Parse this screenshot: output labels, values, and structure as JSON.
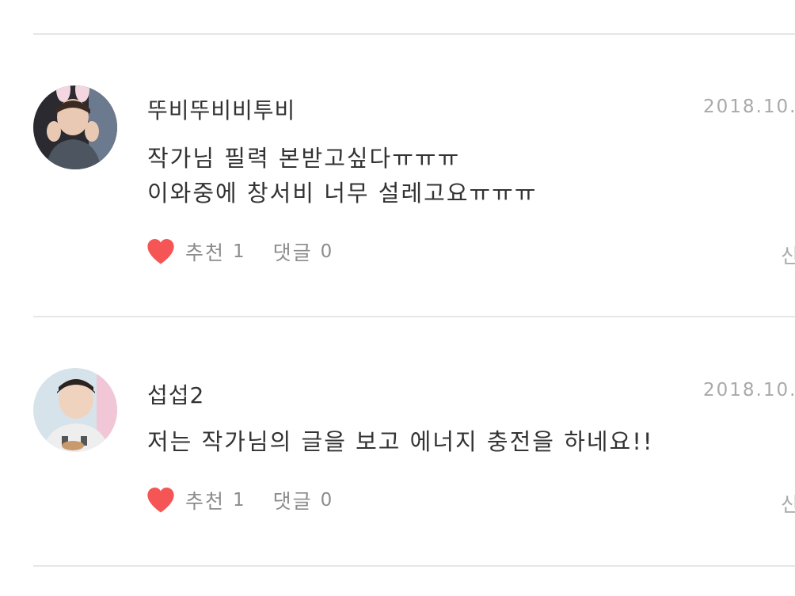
{
  "comments": [
    {
      "author": "뚜비뚜비비투비",
      "date": "2018.10.",
      "lines": [
        "작가님 필력 본받고싶다ㅠㅠㅠ",
        "이와중에 창서비 너무 설레고요ㅠㅠㅠ"
      ],
      "like_label": "추천",
      "like_count": "1",
      "reply_label": "댓글",
      "reply_count": "0",
      "report_label": "신"
    },
    {
      "author": "섭섭2",
      "date": "2018.10.",
      "lines": [
        "저는 작가님의 글을 보고 에너지 충전을 하네요!!"
      ],
      "like_label": "추천",
      "like_count": "1",
      "reply_label": "댓글",
      "reply_count": "0",
      "report_label": "신"
    }
  ],
  "colors": {
    "heart": "#f55555",
    "divider": "#e6e6e6",
    "muted_text": "#8c8c8c",
    "date_text": "#a9a9a9"
  }
}
